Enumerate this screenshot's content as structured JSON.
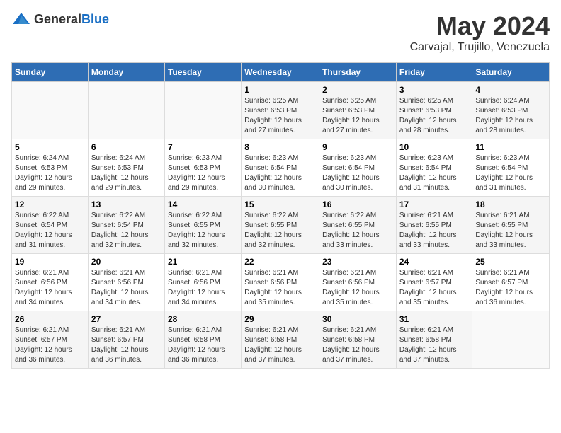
{
  "logo": {
    "general": "General",
    "blue": "Blue"
  },
  "header": {
    "month": "May 2024",
    "location": "Carvajal, Trujillo, Venezuela"
  },
  "days_of_week": [
    "Sunday",
    "Monday",
    "Tuesday",
    "Wednesday",
    "Thursday",
    "Friday",
    "Saturday"
  ],
  "weeks": [
    [
      {
        "day": "",
        "info": ""
      },
      {
        "day": "",
        "info": ""
      },
      {
        "day": "",
        "info": ""
      },
      {
        "day": "1",
        "info": "Sunrise: 6:25 AM\nSunset: 6:53 PM\nDaylight: 12 hours\nand 27 minutes."
      },
      {
        "day": "2",
        "info": "Sunrise: 6:25 AM\nSunset: 6:53 PM\nDaylight: 12 hours\nand 27 minutes."
      },
      {
        "day": "3",
        "info": "Sunrise: 6:25 AM\nSunset: 6:53 PM\nDaylight: 12 hours\nand 28 minutes."
      },
      {
        "day": "4",
        "info": "Sunrise: 6:24 AM\nSunset: 6:53 PM\nDaylight: 12 hours\nand 28 minutes."
      }
    ],
    [
      {
        "day": "5",
        "info": "Sunrise: 6:24 AM\nSunset: 6:53 PM\nDaylight: 12 hours\nand 29 minutes."
      },
      {
        "day": "6",
        "info": "Sunrise: 6:24 AM\nSunset: 6:53 PM\nDaylight: 12 hours\nand 29 minutes."
      },
      {
        "day": "7",
        "info": "Sunrise: 6:23 AM\nSunset: 6:53 PM\nDaylight: 12 hours\nand 29 minutes."
      },
      {
        "day": "8",
        "info": "Sunrise: 6:23 AM\nSunset: 6:54 PM\nDaylight: 12 hours\nand 30 minutes."
      },
      {
        "day": "9",
        "info": "Sunrise: 6:23 AM\nSunset: 6:54 PM\nDaylight: 12 hours\nand 30 minutes."
      },
      {
        "day": "10",
        "info": "Sunrise: 6:23 AM\nSunset: 6:54 PM\nDaylight: 12 hours\nand 31 minutes."
      },
      {
        "day": "11",
        "info": "Sunrise: 6:23 AM\nSunset: 6:54 PM\nDaylight: 12 hours\nand 31 minutes."
      }
    ],
    [
      {
        "day": "12",
        "info": "Sunrise: 6:22 AM\nSunset: 6:54 PM\nDaylight: 12 hours\nand 31 minutes."
      },
      {
        "day": "13",
        "info": "Sunrise: 6:22 AM\nSunset: 6:54 PM\nDaylight: 12 hours\nand 32 minutes."
      },
      {
        "day": "14",
        "info": "Sunrise: 6:22 AM\nSunset: 6:55 PM\nDaylight: 12 hours\nand 32 minutes."
      },
      {
        "day": "15",
        "info": "Sunrise: 6:22 AM\nSunset: 6:55 PM\nDaylight: 12 hours\nand 32 minutes."
      },
      {
        "day": "16",
        "info": "Sunrise: 6:22 AM\nSunset: 6:55 PM\nDaylight: 12 hours\nand 33 minutes."
      },
      {
        "day": "17",
        "info": "Sunrise: 6:21 AM\nSunset: 6:55 PM\nDaylight: 12 hours\nand 33 minutes."
      },
      {
        "day": "18",
        "info": "Sunrise: 6:21 AM\nSunset: 6:55 PM\nDaylight: 12 hours\nand 33 minutes."
      }
    ],
    [
      {
        "day": "19",
        "info": "Sunrise: 6:21 AM\nSunset: 6:56 PM\nDaylight: 12 hours\nand 34 minutes."
      },
      {
        "day": "20",
        "info": "Sunrise: 6:21 AM\nSunset: 6:56 PM\nDaylight: 12 hours\nand 34 minutes."
      },
      {
        "day": "21",
        "info": "Sunrise: 6:21 AM\nSunset: 6:56 PM\nDaylight: 12 hours\nand 34 minutes."
      },
      {
        "day": "22",
        "info": "Sunrise: 6:21 AM\nSunset: 6:56 PM\nDaylight: 12 hours\nand 35 minutes."
      },
      {
        "day": "23",
        "info": "Sunrise: 6:21 AM\nSunset: 6:56 PM\nDaylight: 12 hours\nand 35 minutes."
      },
      {
        "day": "24",
        "info": "Sunrise: 6:21 AM\nSunset: 6:57 PM\nDaylight: 12 hours\nand 35 minutes."
      },
      {
        "day": "25",
        "info": "Sunrise: 6:21 AM\nSunset: 6:57 PM\nDaylight: 12 hours\nand 36 minutes."
      }
    ],
    [
      {
        "day": "26",
        "info": "Sunrise: 6:21 AM\nSunset: 6:57 PM\nDaylight: 12 hours\nand 36 minutes."
      },
      {
        "day": "27",
        "info": "Sunrise: 6:21 AM\nSunset: 6:57 PM\nDaylight: 12 hours\nand 36 minutes."
      },
      {
        "day": "28",
        "info": "Sunrise: 6:21 AM\nSunset: 6:58 PM\nDaylight: 12 hours\nand 36 minutes."
      },
      {
        "day": "29",
        "info": "Sunrise: 6:21 AM\nSunset: 6:58 PM\nDaylight: 12 hours\nand 37 minutes."
      },
      {
        "day": "30",
        "info": "Sunrise: 6:21 AM\nSunset: 6:58 PM\nDaylight: 12 hours\nand 37 minutes."
      },
      {
        "day": "31",
        "info": "Sunrise: 6:21 AM\nSunset: 6:58 PM\nDaylight: 12 hours\nand 37 minutes."
      },
      {
        "day": "",
        "info": ""
      }
    ]
  ]
}
